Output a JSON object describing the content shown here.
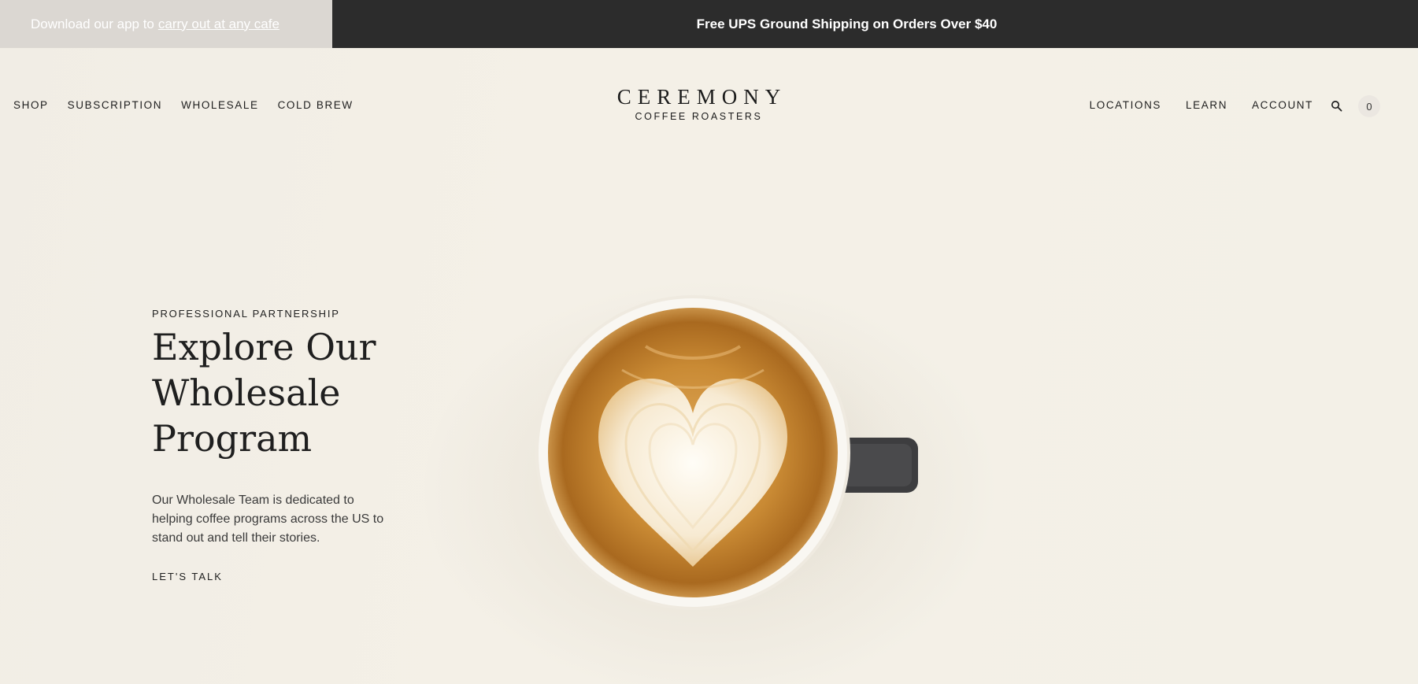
{
  "announcement": {
    "app_prefix": "Download our app to",
    "app_link": "carry out at any cafe",
    "shipping": "Free UPS Ground Shipping on Orders Over $40"
  },
  "nav": {
    "left": [
      "SHOP",
      "SUBSCRIPTION",
      "WHOLESALE",
      "COLD BREW"
    ],
    "right": [
      "LOCATIONS",
      "LEARN",
      "ACCOUNT"
    ],
    "cart_count": "0"
  },
  "logo": {
    "main": "CEREMONY",
    "sub": "COFFEE ROASTERS"
  },
  "hero": {
    "eyebrow": "PROFESSIONAL PARTNERSHIP",
    "headline": "Explore Our Wholesale Program",
    "description": "Our Wholesale Team is dedicated to helping coffee programs across the US to stand out and tell their stories.",
    "cta": "LET'S TALK"
  },
  "colors": {
    "announce_left_bg": "#dbd7d2",
    "announce_right_bg": "#2c2c2c",
    "page_bg": "#f3efe6"
  }
}
